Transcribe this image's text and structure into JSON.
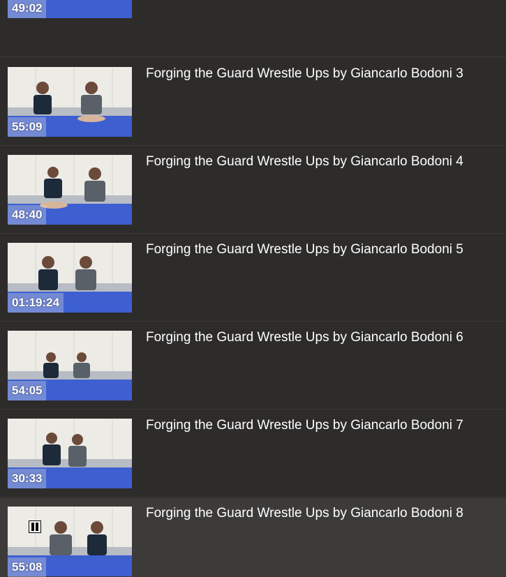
{
  "playlist": {
    "items": [
      {
        "title": "",
        "duration": "49:02",
        "active": false
      },
      {
        "title": "Forging the Guard Wrestle Ups by Giancarlo Bodoni 3",
        "duration": "55:09",
        "active": false
      },
      {
        "title": "Forging the Guard Wrestle Ups by Giancarlo Bodoni 4",
        "duration": "48:40",
        "active": false
      },
      {
        "title": "Forging the Guard Wrestle Ups by Giancarlo Bodoni 5",
        "duration": "01:19:24",
        "active": false
      },
      {
        "title": "Forging the Guard Wrestle Ups by Giancarlo Bodoni 6",
        "duration": "54:05",
        "active": false
      },
      {
        "title": "Forging the Guard Wrestle Ups by Giancarlo Bodoni 7",
        "duration": "30:33",
        "active": false
      },
      {
        "title": "Forging the Guard Wrestle Ups by Giancarlo Bodoni 8",
        "duration": "55:08",
        "active": true,
        "icon": "pause-icon"
      }
    ]
  },
  "colors": {
    "background": "#2d2c2b",
    "active_row": "#3c3b3a",
    "divider": "#3b3a39",
    "mat_blue": "#3d5fd0",
    "wall": "#ecebe6"
  }
}
